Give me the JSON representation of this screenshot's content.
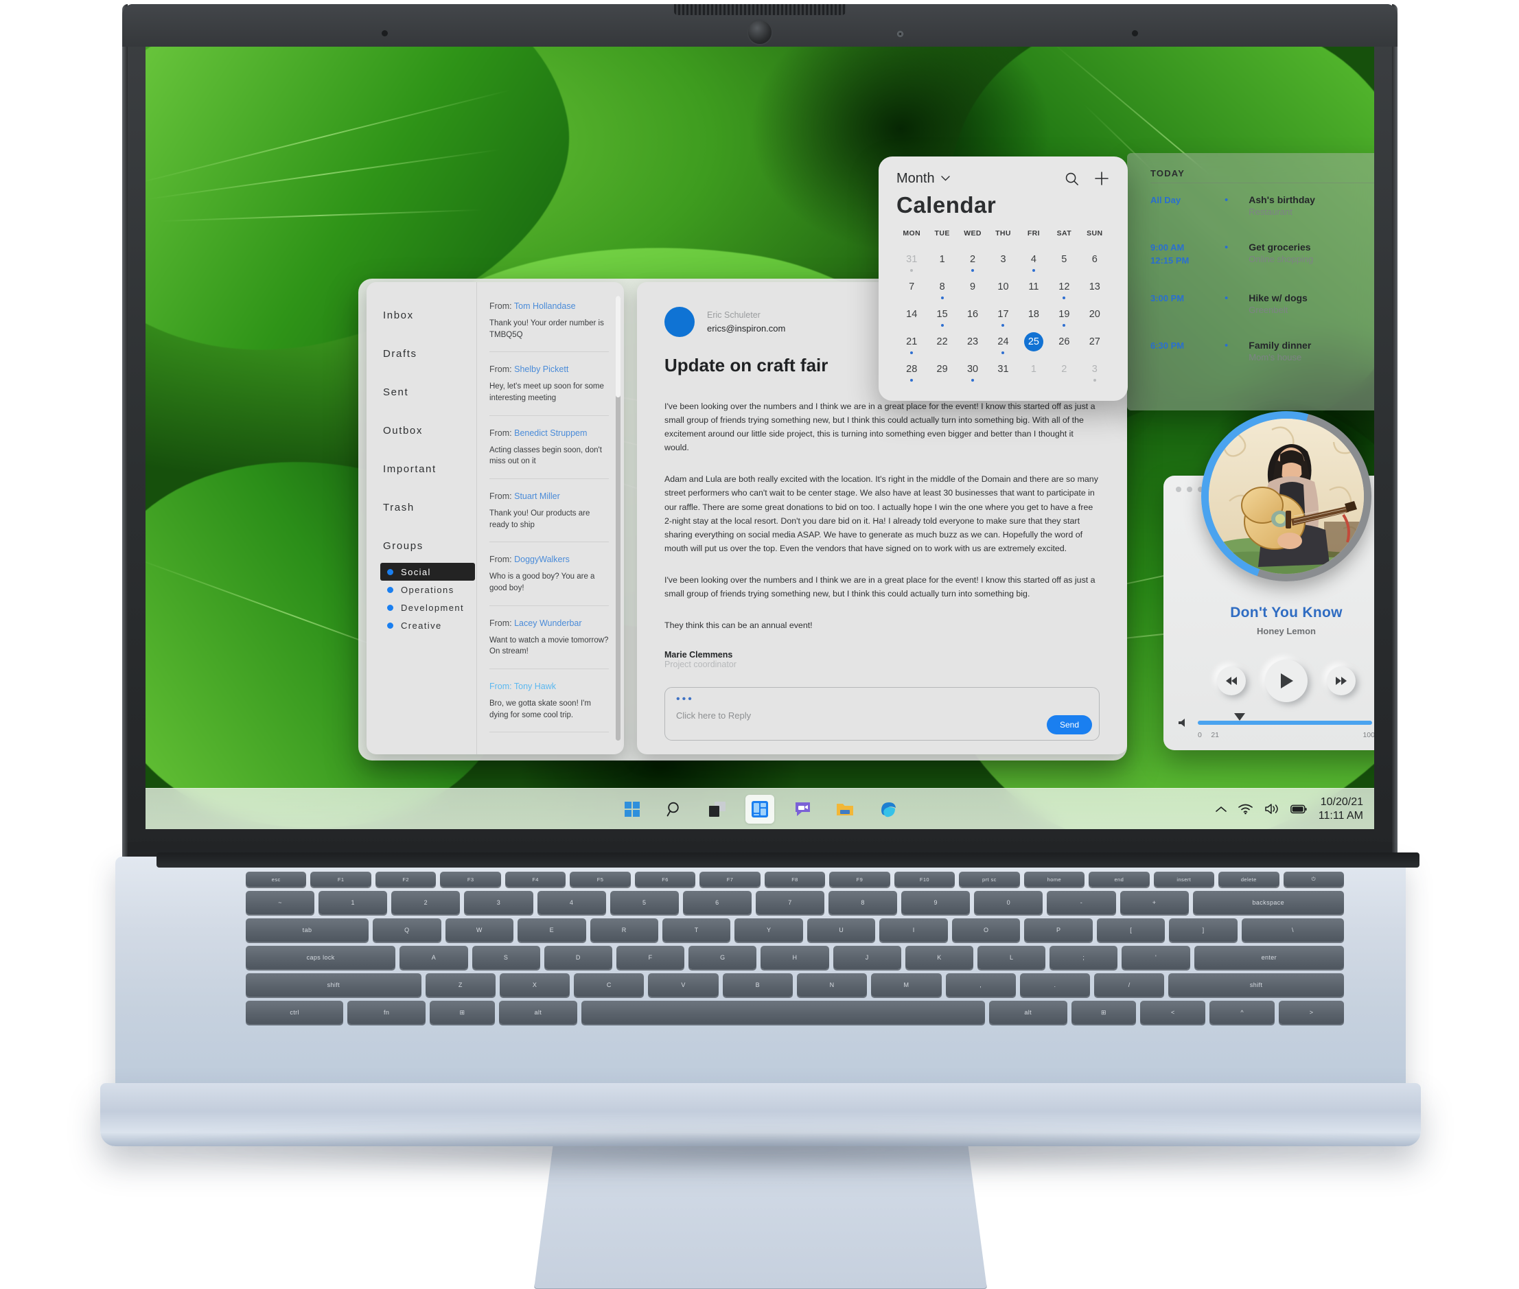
{
  "desktop": {
    "wallpaper_name": "green-leaves-wallpaper"
  },
  "taskbar": {
    "items": [
      {
        "name": "start-button",
        "label": "Start"
      },
      {
        "name": "search-icon",
        "label": "Search"
      },
      {
        "name": "task-view-icon",
        "label": "Task View"
      },
      {
        "name": "widgets-icon",
        "label": "Widgets"
      },
      {
        "name": "chat-icon",
        "label": "Chat"
      },
      {
        "name": "file-explorer-icon",
        "label": "File Explorer"
      },
      {
        "name": "edge-icon",
        "label": "Microsoft Edge"
      }
    ],
    "tray": {
      "chevron": "Show hidden icons",
      "wifi": "Network",
      "volume": "Volume",
      "battery": "Battery",
      "date": "10/20/21",
      "time": "11:11 AM"
    }
  },
  "mail": {
    "nav": [
      "Inbox",
      "Drafts",
      "Sent",
      "Outbox",
      "Important",
      "Trash"
    ],
    "groups_label": "Groups",
    "groups": [
      {
        "label": "Social",
        "selected": true
      },
      {
        "label": "Operations",
        "selected": false
      },
      {
        "label": "Development",
        "selected": false
      },
      {
        "label": "Creative",
        "selected": false
      }
    ],
    "from_prefix": "From: ",
    "messages": [
      {
        "sender": "Tom Hollandase",
        "preview": "Thank you! Your order number is TMBQ5Q",
        "unread": false
      },
      {
        "sender": "Shelby Pickett",
        "preview": "Hey, let's meet up soon for some interesting meeting",
        "unread": false
      },
      {
        "sender": "Benedict Struppem",
        "preview": "Acting classes begin soon, don't miss out on it",
        "unread": false
      },
      {
        "sender": "Stuart Miller",
        "preview": "Thank you! Our products are ready to ship",
        "unread": false
      },
      {
        "sender": "DoggyWalkers",
        "preview": "Who is a good boy? You are a good boy!",
        "unread": false
      },
      {
        "sender": "Lacey Wunderbar",
        "preview": "Want to watch a movie tomorrow? On stream!",
        "unread": false
      },
      {
        "sender": "Tony Hawk",
        "preview": "Bro, we gotta skate soon! I'm dying for some cool trip.",
        "unread": true
      }
    ],
    "reading": {
      "sender_name": "Eric Schuleter",
      "sender_email": "erics@inspiron.com",
      "subject": "Update on craft fair",
      "paragraphs": [
        "I've been looking over the numbers and I think we are in a great place for the event! I know this started off as just a small group of friends trying something new, but I think this could actually turn into something big. With all of the excitement around our little side project, this is turning into something even bigger and better than I thought it would.",
        " Adam and Lula are both really excited with the location. It's right in the middle of the Domain and there are so many street performers who can't wait to be center stage. We also have at least 30 businesses that want to participate in our raffle. There are some great donations to bid on too. I actually hope I win the one where you get to have a free 2-night stay at the local resort. Don't you dare bid on it. Ha! I already told everyone to make sure that they start sharing everything on social media ASAP. We have to generate as much buzz as we can. Hopefully the word of mouth will put us over the top. Even the vendors that have signed on to work with us are extremely excited.",
        "I've been looking over the numbers and I think we are in a great place for the event! I know this started off as just a small group of friends trying something new, but I think this could actually turn into something big.",
        "They think this can be an annual event!"
      ],
      "signature_name": "Marie Clemmens",
      "signature_role": "Project coordinator",
      "reply_placeholder": "Click here to Reply",
      "send_label": "Send"
    }
  },
  "calendar": {
    "view_label": "Month",
    "title": "Calendar",
    "dow": [
      "MON",
      "TUE",
      "WED",
      "THU",
      "FRI",
      "SAT",
      "SUN"
    ],
    "cells": [
      {
        "d": "31",
        "muted": true,
        "dot": true
      },
      {
        "d": "1",
        "muted": false,
        "dot": false
      },
      {
        "d": "2",
        "muted": false,
        "dot": true
      },
      {
        "d": "3",
        "muted": false,
        "dot": false
      },
      {
        "d": "4",
        "muted": false,
        "dot": true
      },
      {
        "d": "5",
        "muted": false,
        "dot": false
      },
      {
        "d": "6",
        "muted": false,
        "dot": false
      },
      {
        "d": "7",
        "muted": false,
        "dot": false
      },
      {
        "d": "8",
        "muted": false,
        "dot": true
      },
      {
        "d": "9",
        "muted": false,
        "dot": false
      },
      {
        "d": "10",
        "muted": false,
        "dot": false
      },
      {
        "d": "11",
        "muted": false,
        "dot": false
      },
      {
        "d": "12",
        "muted": false,
        "dot": true
      },
      {
        "d": "13",
        "muted": false,
        "dot": false
      },
      {
        "d": "14",
        "muted": false,
        "dot": false
      },
      {
        "d": "15",
        "muted": false,
        "dot": true
      },
      {
        "d": "16",
        "muted": false,
        "dot": false
      },
      {
        "d": "17",
        "muted": false,
        "dot": true
      },
      {
        "d": "18",
        "muted": false,
        "dot": false
      },
      {
        "d": "19",
        "muted": false,
        "dot": true
      },
      {
        "d": "20",
        "muted": false,
        "dot": false
      },
      {
        "d": "21",
        "muted": false,
        "dot": true
      },
      {
        "d": "22",
        "muted": false,
        "dot": false
      },
      {
        "d": "23",
        "muted": false,
        "dot": false
      },
      {
        "d": "24",
        "muted": false,
        "dot": true
      },
      {
        "d": "25",
        "muted": false,
        "dot": false,
        "today": true
      },
      {
        "d": "26",
        "muted": false,
        "dot": false
      },
      {
        "d": "27",
        "muted": false,
        "dot": false
      },
      {
        "d": "28",
        "muted": false,
        "dot": true
      },
      {
        "d": "29",
        "muted": false,
        "dot": false
      },
      {
        "d": "30",
        "muted": false,
        "dot": true
      },
      {
        "d": "31",
        "muted": false,
        "dot": false
      },
      {
        "d": "1",
        "muted": true,
        "dot": false
      },
      {
        "d": "2",
        "muted": true,
        "dot": false
      },
      {
        "d": "3",
        "muted": true,
        "dot": true
      }
    ],
    "accent": "#1272d3"
  },
  "agenda": {
    "heading": "TODAY",
    "events": [
      {
        "time": "All Day",
        "title": "Ash's birthday",
        "location": "Restaurant"
      },
      {
        "time": "9:00 AM\n12:15 PM",
        "title": "Get groceries",
        "location": "Online shopping"
      },
      {
        "time": "3:00 PM",
        "title": "Hike w/ dogs",
        "location": "Greenbelt"
      },
      {
        "time": "6:30 PM",
        "title": "Family dinner",
        "location": "Mom's house"
      }
    ]
  },
  "player": {
    "song_title": "Don't You Know",
    "artist": "Honey Lemon",
    "volume_min": "0",
    "volume_value": "21",
    "volume_max": "100",
    "accent": "#4aa3ef",
    "album_art": "woman-playing-acoustic-guitar"
  }
}
